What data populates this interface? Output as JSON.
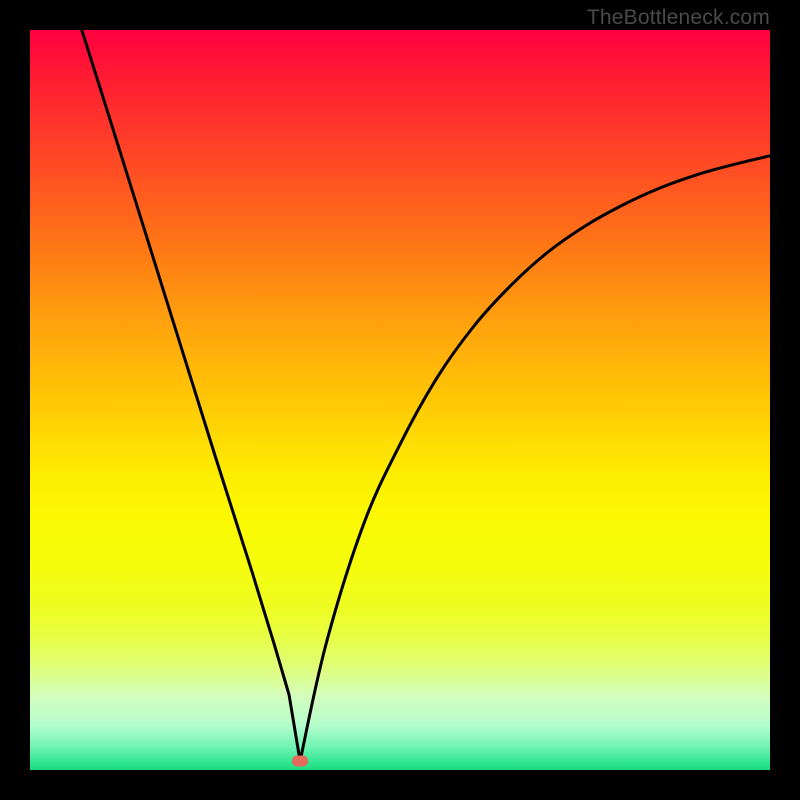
{
  "watermark": "TheBottleneck.com",
  "colors": {
    "frame": "#000000",
    "curve": "#000000",
    "marker": "#e36a5c",
    "gradient_top": "#ff0040",
    "gradient_bottom": "#19db7e"
  },
  "chart_data": {
    "type": "line",
    "title": "",
    "xlabel": "",
    "ylabel": "",
    "xlim": [
      0,
      100
    ],
    "ylim": [
      0,
      100
    ],
    "series": [
      {
        "name": "left-branch",
        "x": [
          7,
          10,
          15,
          20,
          25,
          30,
          33,
          35,
          36.5
        ],
        "values": [
          100,
          90.5,
          74.5,
          58.5,
          42.5,
          26.8,
          17,
          10.2,
          1.2
        ]
      },
      {
        "name": "right-branch",
        "x": [
          36.5,
          40,
          45,
          50,
          55,
          60,
          65,
          70,
          75,
          80,
          85,
          90,
          95,
          100
        ],
        "values": [
          1.2,
          17,
          33,
          44,
          53,
          60,
          65.5,
          70,
          73.5,
          76.3,
          78.6,
          80.4,
          81.8,
          83
        ]
      }
    ],
    "annotations": [
      {
        "name": "minimum-marker",
        "x": 36.5,
        "y": 1.2
      }
    ]
  }
}
